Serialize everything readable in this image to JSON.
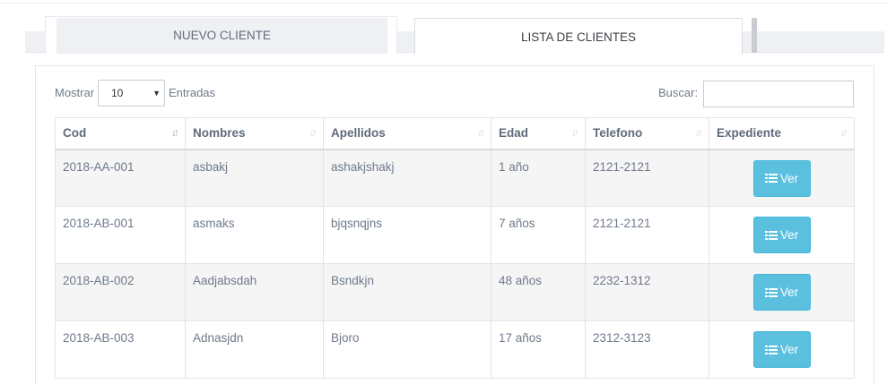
{
  "tabs": [
    {
      "label": "NUEVO CLIENTE",
      "active": false
    },
    {
      "label": "LISTA DE CLIENTES",
      "active": true
    }
  ],
  "length_control": {
    "prefix": "Mostrar",
    "selected": "10",
    "suffix": "Entradas"
  },
  "search": {
    "label": "Buscar:",
    "value": ""
  },
  "table": {
    "columns": [
      "Cod",
      "Nombres",
      "Apellidos",
      "Edad",
      "Telefono",
      "Expediente"
    ],
    "sorted_column": "Cod",
    "rows": [
      {
        "cod": "2018-AA-001",
        "nombres": "asbakj",
        "apellidos": "ashakjshakj",
        "edad": "1 año",
        "telefono": "2121-2121",
        "action": "Ver"
      },
      {
        "cod": "2018-AB-001",
        "nombres": "asmaks",
        "apellidos": "bjqsnqjns",
        "edad": "7 años",
        "telefono": "2121-2121",
        "action": "Ver"
      },
      {
        "cod": "2018-AB-002",
        "nombres": "Aadjabsdah",
        "apellidos": "Bsndkjn",
        "edad": "48 años",
        "telefono": "2232-1312",
        "action": "Ver"
      },
      {
        "cod": "2018-AB-003",
        "nombres": "Adnasjdn",
        "apellidos": "Bjoro",
        "edad": "17 años",
        "telefono": "2312-3123",
        "action": "Ver"
      }
    ]
  },
  "colors": {
    "button": "#5bc0de",
    "stripe": "#f5f5f5",
    "text": "#6f7a8a"
  }
}
